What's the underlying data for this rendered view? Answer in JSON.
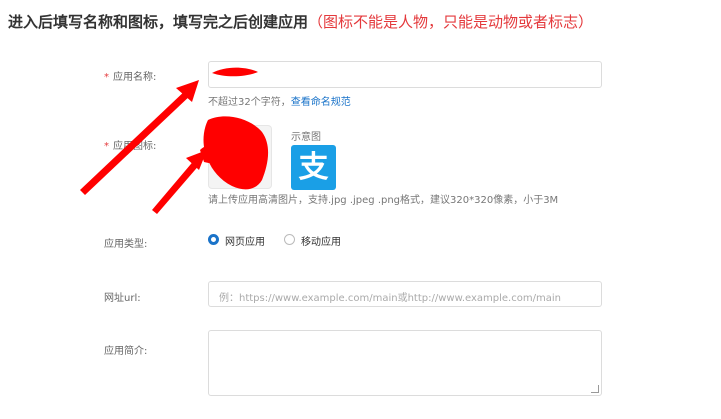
{
  "heading": {
    "main": "进入后填写名称和图标，填写完之后创建应用",
    "note": "（图标不能是人物，只能是动物或者标志）"
  },
  "form": {
    "required_mark": "*",
    "app_name": {
      "label": "应用名称:",
      "hint": "不超过32个字符，",
      "hint_link": "查看命名规范"
    },
    "app_icon": {
      "label": "应用图标:",
      "sample_label": "示意图",
      "sample_glyph": "支",
      "upload_hint": "请上传应用高清图片，支持.jpg .jpeg .png格式，建议320*320像素，小于3M"
    },
    "app_type": {
      "label": "应用类型:",
      "options": [
        {
          "label": "网页应用",
          "selected": true
        },
        {
          "label": "移动应用",
          "selected": false
        }
      ]
    },
    "url": {
      "label": "网址url:",
      "placeholder": "例：https://www.example.com/main或http://www.example.com/main"
    },
    "description": {
      "label": "应用简介:"
    }
  },
  "colors": {
    "accent": "#1a73c9",
    "required": "#e4393c",
    "annotation": "#ff0000",
    "sample_icon_bg": "#1a9fe6"
  }
}
